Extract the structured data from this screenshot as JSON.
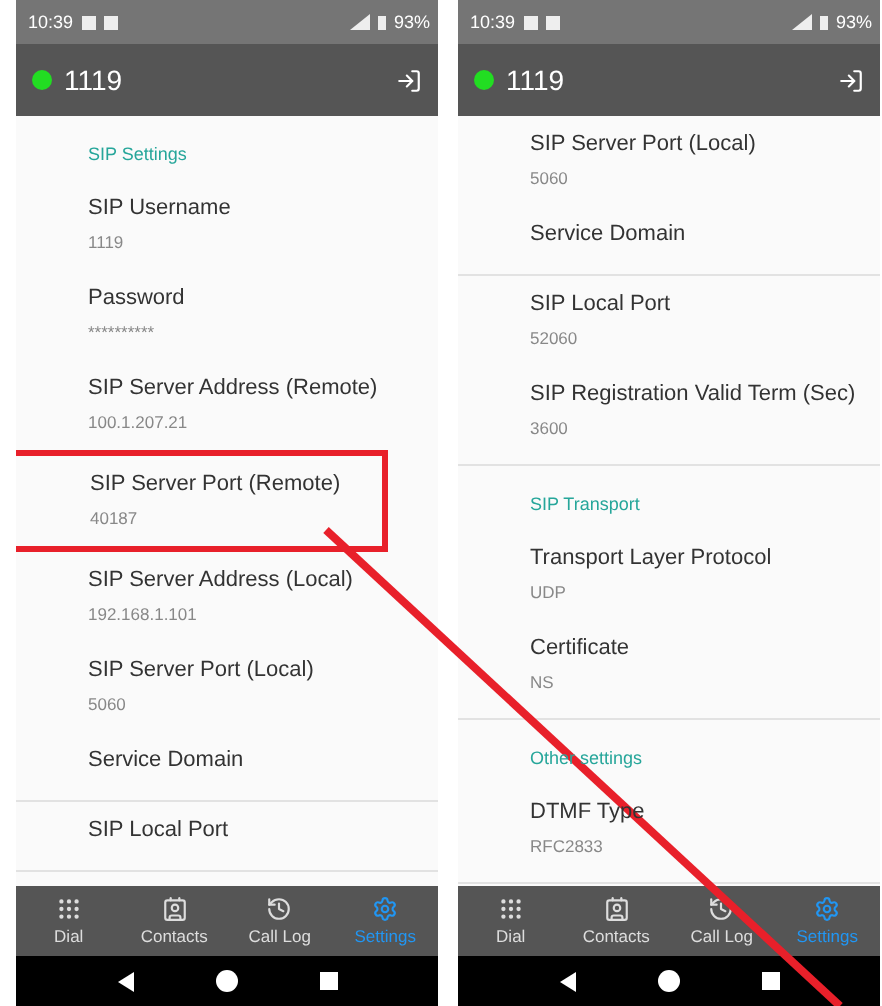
{
  "screens": [
    {
      "status_bar": {
        "time": "10:39",
        "battery": "93%"
      },
      "app_bar": {
        "title": "1119",
        "online": true
      },
      "sections": [
        {
          "header": "SIP Settings",
          "items": [
            {
              "label": "SIP Username",
              "value": "1119",
              "highlighted": false
            },
            {
              "label": "Password",
              "value": "**********",
              "highlighted": false
            },
            {
              "label": "SIP Server Address (Remote)",
              "value": "100.1.207.21",
              "highlighted": false
            },
            {
              "label": "SIP Server Port (Remote)",
              "value": "40187",
              "highlighted": true
            },
            {
              "label": "SIP Server Address (Local)",
              "value": "192.168.1.101",
              "highlighted": false
            },
            {
              "label": "SIP Server Port (Local)",
              "value": "5060",
              "highlighted": false
            },
            {
              "label": "Service Domain",
              "highlighted": false
            }
          ]
        },
        {
          "items": [
            {
              "label": "SIP Local Port",
              "highlighted": false
            }
          ]
        }
      ],
      "nav": [
        {
          "label": "Dial",
          "selected": false
        },
        {
          "label": "Contacts",
          "selected": false
        },
        {
          "label": "Call Log",
          "selected": false
        },
        {
          "label": "Settings",
          "selected": true
        }
      ]
    },
    {
      "status_bar": {
        "time": "10:39",
        "battery": "93%"
      },
      "app_bar": {
        "title": "1119",
        "online": true
      },
      "sections": [
        {
          "items": [
            {
              "label": "SIP Server Port (Local)",
              "value": "5060",
              "highlighted": false
            },
            {
              "label": "Service Domain",
              "highlighted": false
            }
          ]
        },
        {
          "items": [
            {
              "label": "SIP Local Port",
              "value": "52060",
              "highlighted": false
            },
            {
              "label": "SIP Registration Valid Term (Sec)",
              "value": "3600",
              "highlighted": false
            }
          ]
        },
        {
          "header": "SIP Transport",
          "items": [
            {
              "label": "Transport Layer Protocol",
              "value": "UDP",
              "highlighted": false
            },
            {
              "label": "Certificate",
              "value": "NS",
              "highlighted": false
            }
          ]
        },
        {
          "header": "Other settings",
          "items": [
            {
              "label": "DTMF Type",
              "value": "RFC2833",
              "highlighted": false
            }
          ]
        }
      ],
      "nav": [
        {
          "label": "Dial",
          "selected": false
        },
        {
          "label": "Contacts",
          "selected": false
        },
        {
          "label": "Call Log",
          "selected": false
        },
        {
          "label": "Settings",
          "selected": true
        }
      ]
    }
  ]
}
